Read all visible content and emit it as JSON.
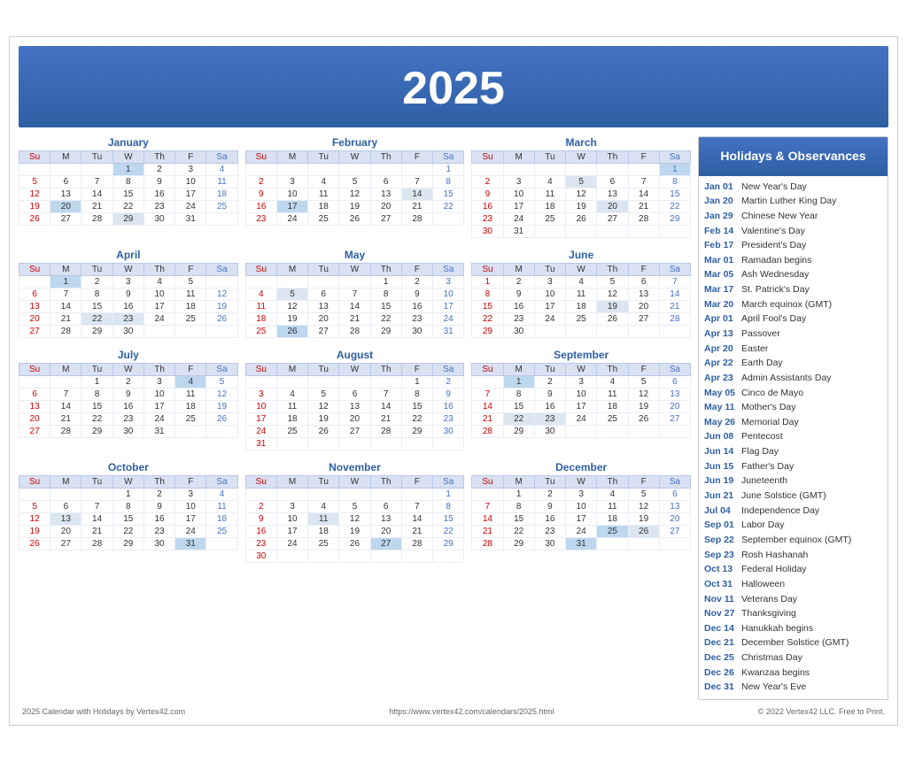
{
  "header": {
    "year": "2025"
  },
  "months": [
    {
      "name": "January",
      "days": [
        [
          "",
          "",
          "",
          "1h",
          "2",
          "3",
          "4s"
        ],
        [
          "5su",
          "6",
          "7",
          "8",
          "9",
          "10",
          "11s"
        ],
        [
          "12su",
          "13",
          "14",
          "15",
          "16",
          "17",
          "18s"
        ],
        [
          "19su",
          "20hl",
          "21",
          "22",
          "23",
          "24",
          "25s"
        ],
        [
          "26su",
          "27",
          "28",
          "29sp",
          "30",
          "31",
          ""
        ]
      ]
    },
    {
      "name": "February",
      "days": [
        [
          "",
          "",
          "",
          "",
          "",
          "",
          "1s"
        ],
        [
          "2su",
          "3",
          "4",
          "5",
          "6",
          "7",
          "8s"
        ],
        [
          "9su",
          "10",
          "11",
          "12",
          "13",
          "14sp",
          "15s"
        ],
        [
          "16su",
          "17hl",
          "18",
          "19",
          "20",
          "21",
          "22s"
        ],
        [
          "23su",
          "24",
          "25",
          "26",
          "27",
          "28",
          ""
        ]
      ]
    },
    {
      "name": "March",
      "days": [
        [
          "",
          "",
          "",
          "",
          "",
          "",
          "1h"
        ],
        [
          "2su",
          "3",
          "4",
          "5sp",
          "6",
          "7",
          "8s"
        ],
        [
          "9su",
          "10",
          "11",
          "12",
          "13",
          "14",
          "15s"
        ],
        [
          "16su",
          "17",
          "18",
          "19",
          "20sp",
          "21",
          "22s"
        ],
        [
          "23su",
          "24",
          "25",
          "26",
          "27",
          "28",
          "29s"
        ],
        [
          "30su",
          "31",
          "",
          "",
          "",
          "",
          ""
        ]
      ]
    },
    {
      "name": "April",
      "days": [
        [
          "",
          "1h",
          "2",
          "3",
          "4",
          "5",
          ""
        ],
        [
          "6su",
          "7",
          "8",
          "9",
          "10",
          "11",
          "12s"
        ],
        [
          "13su",
          "14",
          "15",
          "16",
          "17",
          "18",
          "19s"
        ],
        [
          "20su",
          "21",
          "22sp",
          "23sp",
          "24",
          "25",
          "26s"
        ],
        [
          "27su",
          "28",
          "29",
          "30",
          "",
          "",
          ""
        ]
      ]
    },
    {
      "name": "May",
      "days": [
        [
          "",
          "",
          "",
          "",
          "1",
          "2",
          "3s"
        ],
        [
          "4su",
          "5sp",
          "6",
          "7",
          "8",
          "9",
          "10s"
        ],
        [
          "11su",
          "12",
          "13",
          "14",
          "15",
          "16",
          "17s"
        ],
        [
          "18su",
          "19",
          "20",
          "21",
          "22",
          "23",
          "24s"
        ],
        [
          "25su",
          "26hl",
          "27",
          "28",
          "29",
          "30",
          "31s"
        ]
      ]
    },
    {
      "name": "June",
      "days": [
        [
          "1su",
          "2",
          "3",
          "4",
          "5",
          "6",
          "7s"
        ],
        [
          "8su",
          "9",
          "10",
          "11",
          "12",
          "13",
          "14s"
        ],
        [
          "15su",
          "16",
          "17",
          "18",
          "19sp",
          "20",
          "21s"
        ],
        [
          "22su",
          "23",
          "24",
          "25",
          "26",
          "27",
          "28s"
        ],
        [
          "29su",
          "30",
          "",
          "",
          "",
          "",
          ""
        ]
      ]
    },
    {
      "name": "July",
      "days": [
        [
          "",
          "",
          "1",
          "2",
          "3",
          "4h",
          "5s"
        ],
        [
          "6su",
          "7",
          "8",
          "9",
          "10",
          "11",
          "12s"
        ],
        [
          "13su",
          "14",
          "15",
          "16",
          "17",
          "18",
          "19s"
        ],
        [
          "20su",
          "21",
          "22",
          "23",
          "24",
          "25",
          "26s"
        ],
        [
          "27su",
          "28",
          "29",
          "30",
          "31",
          "",
          ""
        ]
      ]
    },
    {
      "name": "August",
      "days": [
        [
          "",
          "",
          "",
          "",
          "",
          "1",
          "2s"
        ],
        [
          "3su",
          "4",
          "5",
          "6",
          "7",
          "8",
          "9s"
        ],
        [
          "10su",
          "11",
          "12",
          "13",
          "14",
          "15",
          "16s"
        ],
        [
          "17su",
          "18",
          "19",
          "20",
          "21",
          "22",
          "23s"
        ],
        [
          "24su",
          "25",
          "26",
          "27",
          "28",
          "29",
          "30s"
        ],
        [
          "31su",
          "",
          "",
          "",
          "",
          "",
          ""
        ]
      ]
    },
    {
      "name": "September",
      "days": [
        [
          "",
          "1h",
          "2",
          "3",
          "4",
          "5",
          "6s"
        ],
        [
          "7su",
          "8",
          "9",
          "10",
          "11",
          "12",
          "13s"
        ],
        [
          "14su",
          "15",
          "16",
          "17",
          "18",
          "19",
          "20s"
        ],
        [
          "21su",
          "22sp",
          "23sp",
          "24",
          "25",
          "26",
          "27s"
        ],
        [
          "28su",
          "29",
          "30",
          "",
          "",
          "",
          ""
        ]
      ]
    },
    {
      "name": "October",
      "days": [
        [
          "",
          "",
          "",
          "1",
          "2",
          "3",
          "4s"
        ],
        [
          "5su",
          "6",
          "7",
          "8",
          "9",
          "10",
          "11s"
        ],
        [
          "12su",
          "13sp",
          "14",
          "15",
          "16",
          "17",
          "18s"
        ],
        [
          "19su",
          "20",
          "21",
          "22",
          "23",
          "24",
          "25s"
        ],
        [
          "26su",
          "27",
          "28",
          "29",
          "30",
          "31h",
          ""
        ]
      ]
    },
    {
      "name": "November",
      "days": [
        [
          "",
          "",
          "",
          "",
          "",
          "",
          "1s"
        ],
        [
          "2su",
          "3",
          "4",
          "5",
          "6",
          "7",
          "8s"
        ],
        [
          "9su",
          "10",
          "11sp",
          "12",
          "13",
          "14",
          "15s"
        ],
        [
          "16su",
          "17",
          "18",
          "19",
          "20",
          "21",
          "22s"
        ],
        [
          "23su",
          "24",
          "25",
          "26",
          "27h",
          "28",
          "29s"
        ],
        [
          "30su",
          "",
          "",
          "",
          "",
          "",
          ""
        ]
      ]
    },
    {
      "name": "December",
      "days": [
        [
          "",
          "1",
          "2",
          "3",
          "4",
          "5",
          "6s"
        ],
        [
          "7su",
          "8",
          "9",
          "10",
          "11",
          "12",
          "13s"
        ],
        [
          "14su",
          "15",
          "16",
          "17",
          "18",
          "19",
          "20s"
        ],
        [
          "21su",
          "22",
          "23",
          "24",
          "25h",
          "26sp",
          "27s"
        ],
        [
          "28su",
          "29",
          "30",
          "31h",
          "",
          "",
          ""
        ]
      ]
    }
  ],
  "holidays": [
    {
      "date": "Jan 01",
      "event": "New Year's Day"
    },
    {
      "date": "Jan 20",
      "event": "Martin Luther King Day"
    },
    {
      "date": "Jan 29",
      "event": "Chinese New Year"
    },
    {
      "date": "Feb 14",
      "event": "Valentine's Day"
    },
    {
      "date": "Feb 17",
      "event": "President's Day"
    },
    {
      "date": "Mar 01",
      "event": "Ramadan begins"
    },
    {
      "date": "Mar 05",
      "event": "Ash Wednesday"
    },
    {
      "date": "Mar 17",
      "event": "St. Patrick's Day"
    },
    {
      "date": "Mar 20",
      "event": "March equinox (GMT)"
    },
    {
      "date": "Apr 01",
      "event": "April Fool's Day"
    },
    {
      "date": "Apr 13",
      "event": "Passover"
    },
    {
      "date": "Apr 20",
      "event": "Easter"
    },
    {
      "date": "Apr 22",
      "event": "Earth Day"
    },
    {
      "date": "Apr 23",
      "event": "Admin Assistants Day"
    },
    {
      "date": "May 05",
      "event": "Cinco de Mayo"
    },
    {
      "date": "May 11",
      "event": "Mother's Day"
    },
    {
      "date": "May 26",
      "event": "Memorial Day"
    },
    {
      "date": "Jun 08",
      "event": "Pentecost"
    },
    {
      "date": "Jun 14",
      "event": "Flag Day"
    },
    {
      "date": "Jun 15",
      "event": "Father's Day"
    },
    {
      "date": "Jun 19",
      "event": "Juneteenth"
    },
    {
      "date": "Jun 21",
      "event": "June Solstice (GMT)"
    },
    {
      "date": "Jul 04",
      "event": "Independence Day"
    },
    {
      "date": "Sep 01",
      "event": "Labor Day"
    },
    {
      "date": "Sep 22",
      "event": "September equinox (GMT)"
    },
    {
      "date": "Sep 23",
      "event": "Rosh Hashanah"
    },
    {
      "date": "Oct 13",
      "event": "Federal Holiday"
    },
    {
      "date": "Oct 31",
      "event": "Halloween"
    },
    {
      "date": "Nov 11",
      "event": "Veterans Day"
    },
    {
      "date": "Nov 27",
      "event": "Thanksgiving"
    },
    {
      "date": "Dec 14",
      "event": "Hanukkah begins"
    },
    {
      "date": "Dec 21",
      "event": "December Solstice (GMT)"
    },
    {
      "date": "Dec 25",
      "event": "Christmas Day"
    },
    {
      "date": "Dec 26",
      "event": "Kwanzaa begins"
    },
    {
      "date": "Dec 31",
      "event": "New Year's Eve"
    }
  ],
  "sidebar_header": "Holidays &\nObservances",
  "footer": {
    "left": "2025 Calendar with Holidays by Vertex42.com",
    "center": "https://www.vertex42.com/calendars/2025.html",
    "right": "© 2022 Vertex42 LLC. Free to Print."
  }
}
